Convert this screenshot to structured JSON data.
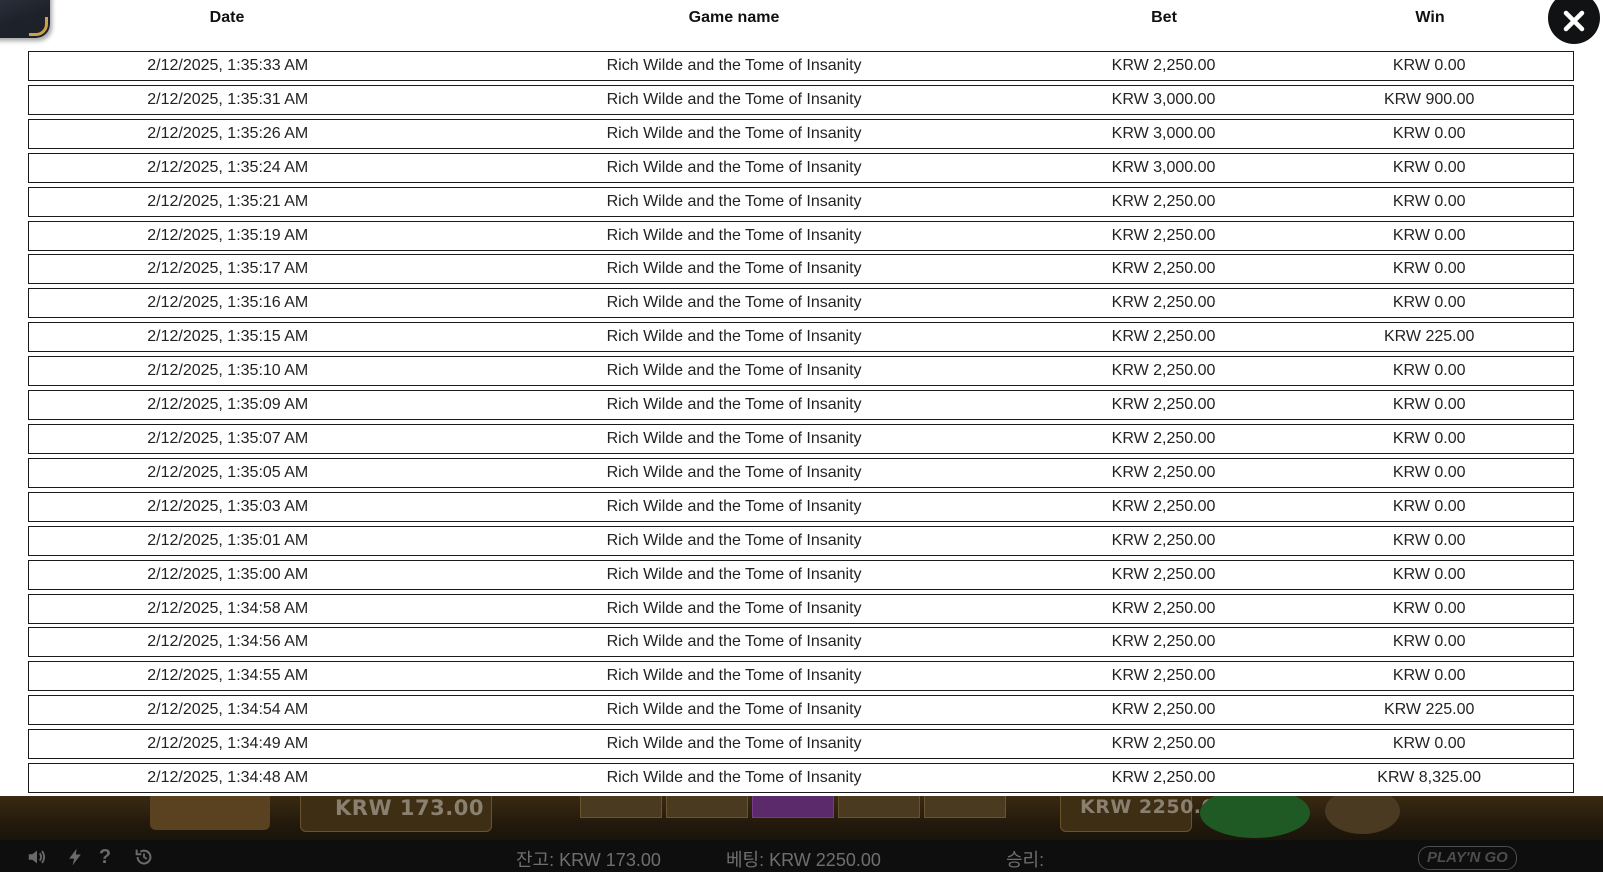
{
  "history": {
    "columns": {
      "date": "Date",
      "game": "Game name",
      "bet": "Bet",
      "win": "Win"
    },
    "rows": [
      {
        "date": "2/12/2025, 1:35:33 AM",
        "game": "Rich Wilde and the Tome of Insanity",
        "bet": "KRW 2,250.00",
        "win": "KRW 0.00"
      },
      {
        "date": "2/12/2025, 1:35:31 AM",
        "game": "Rich Wilde and the Tome of Insanity",
        "bet": "KRW 3,000.00",
        "win": "KRW 900.00"
      },
      {
        "date": "2/12/2025, 1:35:26 AM",
        "game": "Rich Wilde and the Tome of Insanity",
        "bet": "KRW 3,000.00",
        "win": "KRW 0.00"
      },
      {
        "date": "2/12/2025, 1:35:24 AM",
        "game": "Rich Wilde and the Tome of Insanity",
        "bet": "KRW 3,000.00",
        "win": "KRW 0.00"
      },
      {
        "date": "2/12/2025, 1:35:21 AM",
        "game": "Rich Wilde and the Tome of Insanity",
        "bet": "KRW 2,250.00",
        "win": "KRW 0.00"
      },
      {
        "date": "2/12/2025, 1:35:19 AM",
        "game": "Rich Wilde and the Tome of Insanity",
        "bet": "KRW 2,250.00",
        "win": "KRW 0.00"
      },
      {
        "date": "2/12/2025, 1:35:17 AM",
        "game": "Rich Wilde and the Tome of Insanity",
        "bet": "KRW 2,250.00",
        "win": "KRW 0.00"
      },
      {
        "date": "2/12/2025, 1:35:16 AM",
        "game": "Rich Wilde and the Tome of Insanity",
        "bet": "KRW 2,250.00",
        "win": "KRW 0.00"
      },
      {
        "date": "2/12/2025, 1:35:15 AM",
        "game": "Rich Wilde and the Tome of Insanity",
        "bet": "KRW 2,250.00",
        "win": "KRW 225.00"
      },
      {
        "date": "2/12/2025, 1:35:10 AM",
        "game": "Rich Wilde and the Tome of Insanity",
        "bet": "KRW 2,250.00",
        "win": "KRW 0.00"
      },
      {
        "date": "2/12/2025, 1:35:09 AM",
        "game": "Rich Wilde and the Tome of Insanity",
        "bet": "KRW 2,250.00",
        "win": "KRW 0.00"
      },
      {
        "date": "2/12/2025, 1:35:07 AM",
        "game": "Rich Wilde and the Tome of Insanity",
        "bet": "KRW 2,250.00",
        "win": "KRW 0.00"
      },
      {
        "date": "2/12/2025, 1:35:05 AM",
        "game": "Rich Wilde and the Tome of Insanity",
        "bet": "KRW 2,250.00",
        "win": "KRW 0.00"
      },
      {
        "date": "2/12/2025, 1:35:03 AM",
        "game": "Rich Wilde and the Tome of Insanity",
        "bet": "KRW 2,250.00",
        "win": "KRW 0.00"
      },
      {
        "date": "2/12/2025, 1:35:01 AM",
        "game": "Rich Wilde and the Tome of Insanity",
        "bet": "KRW 2,250.00",
        "win": "KRW 0.00"
      },
      {
        "date": "2/12/2025, 1:35:00 AM",
        "game": "Rich Wilde and the Tome of Insanity",
        "bet": "KRW 2,250.00",
        "win": "KRW 0.00"
      },
      {
        "date": "2/12/2025, 1:34:58 AM",
        "game": "Rich Wilde and the Tome of Insanity",
        "bet": "KRW 2,250.00",
        "win": "KRW 0.00"
      },
      {
        "date": "2/12/2025, 1:34:56 AM",
        "game": "Rich Wilde and the Tome of Insanity",
        "bet": "KRW 2,250.00",
        "win": "KRW 0.00"
      },
      {
        "date": "2/12/2025, 1:34:55 AM",
        "game": "Rich Wilde and the Tome of Insanity",
        "bet": "KRW 2,250.00",
        "win": "KRW 0.00"
      },
      {
        "date": "2/12/2025, 1:34:54 AM",
        "game": "Rich Wilde and the Tome of Insanity",
        "bet": "KRW 2,250.00",
        "win": "KRW 225.00"
      },
      {
        "date": "2/12/2025, 1:34:49 AM",
        "game": "Rich Wilde and the Tome of Insanity",
        "bet": "KRW 2,250.00",
        "win": "KRW 0.00"
      },
      {
        "date": "2/12/2025, 1:34:48 AM",
        "game": "Rich Wilde and the Tome of Insanity",
        "bet": "KRW 2,250.00",
        "win": "KRW 8,325.00"
      }
    ]
  },
  "game_strip": {
    "balance_display": "KRW 173.00",
    "bet_display": "KRW 2250.00"
  },
  "status_bar": {
    "balance": "잔고: KRW 173.00",
    "bet": "베팅: KRW 2250.00",
    "win": "승리:",
    "brand": "PLAY'N GO"
  },
  "icons": {
    "close": "close-icon",
    "sound": "speaker-icon",
    "turbo": "lightning-icon",
    "help": "question-icon",
    "history": "history-icon"
  },
  "colors": {
    "row_border": "#1b1b1b",
    "status_bar_bg": "#0e0e0f",
    "close_bg": "#111214"
  }
}
